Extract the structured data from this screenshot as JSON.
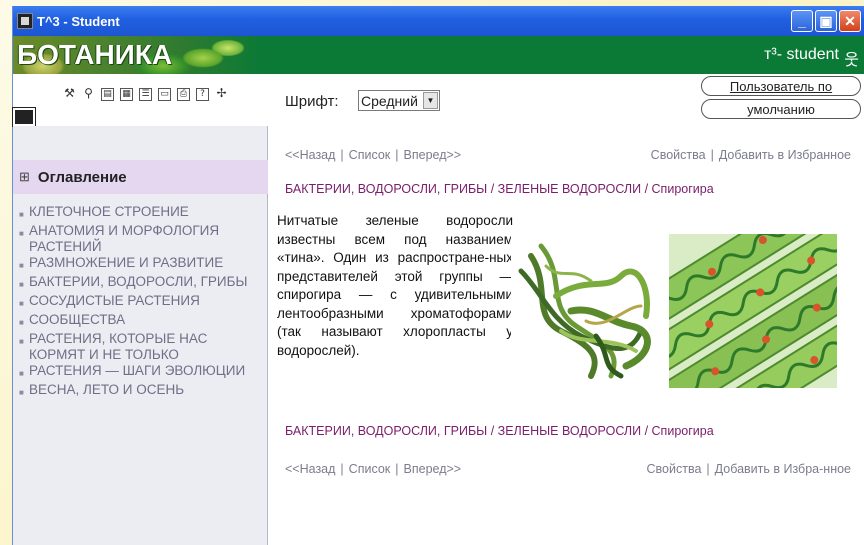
{
  "window": {
    "title": "Т^3 - Student",
    "controls": {
      "minimize": "_",
      "maximize": "▣",
      "close": "✕"
    }
  },
  "header": {
    "brand": "БОТАНИКА",
    "right_text": "т³- student",
    "person_glyph": "웃"
  },
  "toolbar": {
    "icons": [
      "tools-icon",
      "zoom-icon",
      "table-icon",
      "grid-icon",
      "list-icon",
      "page-icon",
      "print-icon",
      "help-icon",
      "exit-icon"
    ],
    "font_label": "Шрифт:",
    "font_value": "Средний",
    "user_line1": "Пользователь по",
    "user_line2": "умолчанию"
  },
  "sidebar": {
    "title": "Оглавление",
    "items": [
      {
        "label": "КЛЕТОЧНОЕ СТРОЕНИЕ"
      },
      {
        "label": "АНАТОМИЯ И МОРФОЛОГИЯ РАСТЕНИЙ"
      },
      {
        "label": "РАЗМНОЖЕНИЕ И РАЗВИТИЕ"
      },
      {
        "label": "БАКТЕРИИ, ВОДОРОСЛИ, ГРИБЫ"
      },
      {
        "label": "СОСУДИСТЫЕ РАСТЕНИЯ"
      },
      {
        "label": "СООБЩЕСТВА"
      },
      {
        "label": "РАСТЕНИЯ, КОТОРЫЕ НАС КОРМЯТ И НЕ ТОЛЬКО"
      },
      {
        "label": "РАСТЕНИЯ — ШАГИ ЭВОЛЮЦИИ"
      },
      {
        "label": "ВЕСНА, ЛЕТО И ОСЕНЬ"
      }
    ]
  },
  "content": {
    "nav": {
      "back": "<<Назад",
      "list": "Список",
      "forward": "Вперед>>",
      "properties": "Свойства",
      "favorite": "Добавить в Избранное",
      "favorite_bottom": "Добавить в Избра-нное",
      "sep": "|"
    },
    "breadcrumb": "БАКТЕРИИ, ВОДОРОСЛИ, ГРИБЫ / ЗЕЛЕНЫЕ ВОДОРОСЛИ / Спирогира",
    "article": "Нитчатые зеленые водоросли известны всем под названием «тина». Один из распростране-ных представителей этой группы — спирогира — с удивительными лентообразными хроматофорами (так называют хлоропласты у водорослей)."
  },
  "colors": {
    "titlebar": "#1f5fe0",
    "header_green": "#0a7a36",
    "toc_header": "#e4d7ef",
    "breadcrumb": "#7a1d6a"
  }
}
